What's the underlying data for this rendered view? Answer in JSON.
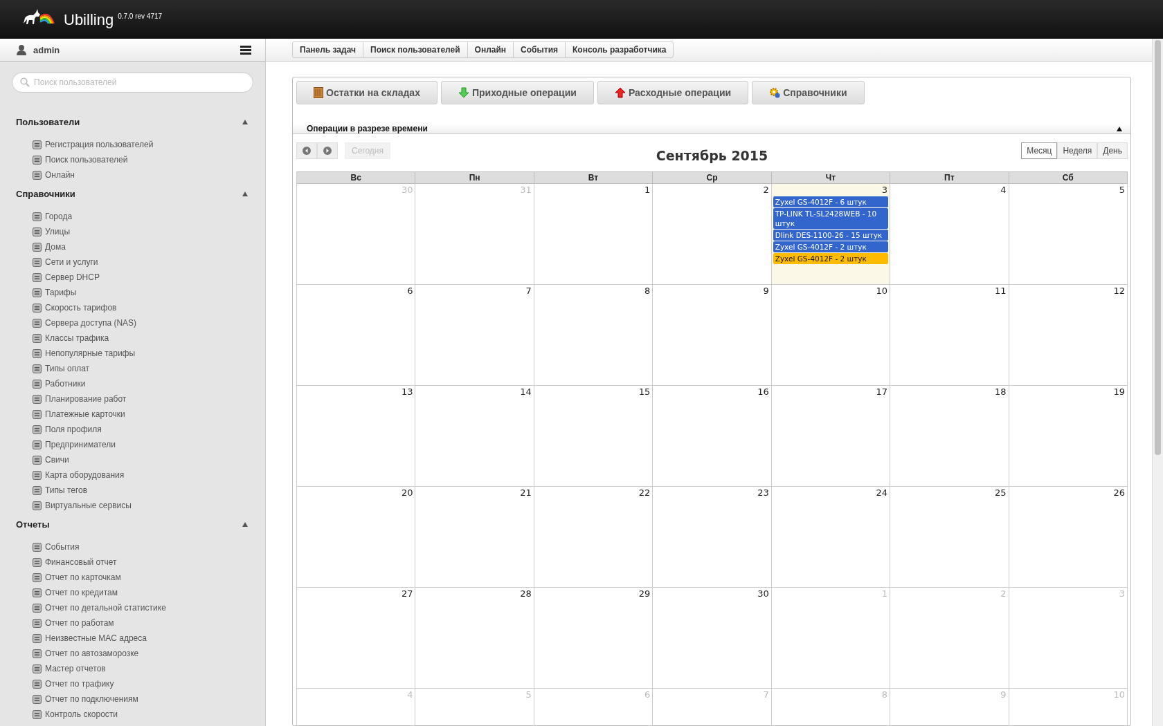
{
  "header": {
    "app_name": "Ubilling",
    "version": "0.7.0 rev 4717"
  },
  "user": {
    "name": "admin"
  },
  "search": {
    "placeholder": "Поиск пользователей"
  },
  "sidebar": {
    "sections": [
      {
        "title": "Пользователи",
        "expanded": true,
        "items": [
          "Регистрация пользователей",
          "Поиск пользователей",
          "Онлайн"
        ]
      },
      {
        "title": "Справочники",
        "expanded": true,
        "items": [
          "Города",
          "Улицы",
          "Дома",
          "Сети и услуги",
          "Сервер DHCP",
          "Тарифы",
          "Скорость тарифов",
          "Сервера доступа (NAS)",
          "Классы трафика",
          "Непопулярные тарифы",
          "Типы оплат",
          "Работники",
          "Планирование работ",
          "Платежные карточки",
          "Поля профиля",
          "Предприниматели",
          "Свичи",
          "Карта оборудования",
          "Типы тегов",
          "Виртуальные сервисы"
        ]
      },
      {
        "title": "Отчеты",
        "expanded": true,
        "items": [
          "События",
          "Финансовый отчет",
          "Отчет по карточкам",
          "Отчет по кредитам",
          "Отчет по детальной статистике",
          "Отчет по работам",
          "Неизвестные MAC адреса",
          "Отчет по автозаморозке",
          "Мастер отчетов",
          "Отчет по трафику",
          "Отчет по подключениям",
          "Контроль скорости"
        ]
      }
    ]
  },
  "breadcrumbs": [
    "Панель задач",
    "Поиск пользователей",
    "Онлайн",
    "События",
    "Консоль разработчика"
  ],
  "toolbar_buttons": [
    {
      "label": "Остатки на складах",
      "kind": "box"
    },
    {
      "label": "Приходные операции",
      "kind": "down"
    },
    {
      "label": "Расходные операции",
      "kind": "up"
    },
    {
      "label": "Справочники",
      "kind": "gear"
    }
  ],
  "panel": {
    "title": "Операции в разрезе времени",
    "expanded": true
  },
  "calendar": {
    "title": "Сентябрь 2015",
    "today_label": "Сегодня",
    "views": [
      {
        "label": "Месяц",
        "selected": true
      },
      {
        "label": "Неделя",
        "selected": false
      },
      {
        "label": "День",
        "selected": false
      }
    ],
    "weekdays": [
      "Вс",
      "Пн",
      "Вт",
      "Ср",
      "Чт",
      "Пт",
      "Сб"
    ],
    "weeks": [
      [
        {
          "day": "30",
          "other_month": true,
          "today": false
        },
        {
          "day": "31",
          "other_month": true,
          "today": false
        },
        {
          "day": "1",
          "other_month": false,
          "today": false
        },
        {
          "day": "2",
          "other_month": false,
          "today": false
        },
        {
          "day": "3",
          "other_month": false,
          "today": true,
          "events": [
            {
              "title": "Zyxel GS-4012F - 6 штук",
              "color": "#3366cc"
            },
            {
              "title": "TP-LINK TL-SL2428WEB - 10 штук",
              "color": "#3366cc"
            },
            {
              "title": "Dlink DES-1100-26 - 15 штук",
              "color": "#3366cc"
            },
            {
              "title": "Zyxel GS-4012F - 2 штук",
              "color": "#3366cc"
            },
            {
              "title": "Zyxel GS-4012F - 2 штук",
              "color": "#ffbb00"
            }
          ]
        },
        {
          "day": "4",
          "other_month": false,
          "today": false
        },
        {
          "day": "5",
          "other_month": false,
          "today": false
        }
      ],
      [
        {
          "day": "6",
          "other_month": false,
          "today": false
        },
        {
          "day": "7",
          "other_month": false,
          "today": false
        },
        {
          "day": "8",
          "other_month": false,
          "today": false
        },
        {
          "day": "9",
          "other_month": false,
          "today": false
        },
        {
          "day": "10",
          "other_month": false,
          "today": false
        },
        {
          "day": "11",
          "other_month": false,
          "today": false
        },
        {
          "day": "12",
          "other_month": false,
          "today": false
        }
      ],
      [
        {
          "day": "13",
          "other_month": false,
          "today": false
        },
        {
          "day": "14",
          "other_month": false,
          "today": false
        },
        {
          "day": "15",
          "other_month": false,
          "today": false
        },
        {
          "day": "16",
          "other_month": false,
          "today": false
        },
        {
          "day": "17",
          "other_month": false,
          "today": false
        },
        {
          "day": "18",
          "other_month": false,
          "today": false
        },
        {
          "day": "19",
          "other_month": false,
          "today": false
        }
      ],
      [
        {
          "day": "20",
          "other_month": false,
          "today": false
        },
        {
          "day": "21",
          "other_month": false,
          "today": false
        },
        {
          "day": "22",
          "other_month": false,
          "today": false
        },
        {
          "day": "23",
          "other_month": false,
          "today": false
        },
        {
          "day": "24",
          "other_month": false,
          "today": false
        },
        {
          "day": "25",
          "other_month": false,
          "today": false
        },
        {
          "day": "26",
          "other_month": false,
          "today": false
        }
      ],
      [
        {
          "day": "27",
          "other_month": false,
          "today": false
        },
        {
          "day": "28",
          "other_month": false,
          "today": false
        },
        {
          "day": "29",
          "other_month": false,
          "today": false
        },
        {
          "day": "30",
          "other_month": false,
          "today": false
        },
        {
          "day": "1",
          "other_month": true,
          "today": false
        },
        {
          "day": "2",
          "other_month": true,
          "today": false
        },
        {
          "day": "3",
          "other_month": true,
          "today": false
        }
      ],
      [
        {
          "day": "4",
          "other_month": true,
          "today": false
        },
        {
          "day": "5",
          "other_month": true,
          "today": false
        },
        {
          "day": "6",
          "other_month": true,
          "today": false
        },
        {
          "day": "7",
          "other_month": true,
          "today": false
        },
        {
          "day": "8",
          "other_month": true,
          "today": false
        },
        {
          "day": "9",
          "other_month": true,
          "today": false
        },
        {
          "day": "10",
          "other_month": true,
          "today": false
        }
      ]
    ]
  }
}
